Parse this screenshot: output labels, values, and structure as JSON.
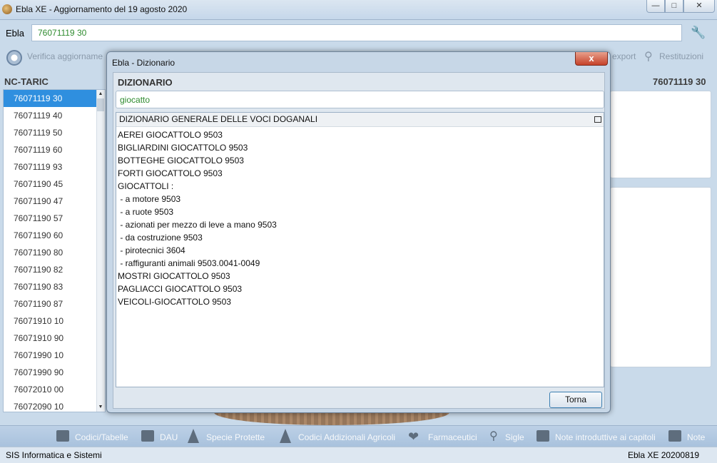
{
  "window": {
    "title": "Ebla XE - Aggiornamento del 19 agosto 2020"
  },
  "search_bar": {
    "label": "Ebla",
    "value": "76071119 30"
  },
  "toolbar": {
    "verify_label": "Verifica aggiorname",
    "export_label": "export",
    "restituzioni_label": "Restituzioni"
  },
  "left_panel": {
    "heading": "NC-TARIC",
    "items": [
      "76071119 30",
      "76071119 40",
      "76071119 50",
      "76071119 60",
      "76071119 93",
      "76071190 45",
      "76071190 47",
      "76071190 57",
      "76071190 60",
      "76071190 80",
      "76071190 82",
      "76071190 83",
      "76071190 87",
      "76071910 10",
      "76071910 90",
      "76071990 10",
      "76071990 90",
      "76072010 00",
      "76072090 10"
    ],
    "selected_index": 0
  },
  "right_panel": {
    "code": "76071119 30"
  },
  "dialog": {
    "title": "Ebla - Dizionario",
    "close_label": "x",
    "heading": "DIZIONARIO",
    "search_value": "giocatto",
    "list_header": "DIZIONARIO GENERALE DELLE VOCI DOGANALI",
    "entries": [
      "AEREI GIOCATTOLO 9503",
      "BIGLIARDINI GIOCATTOLO 9503",
      "BOTTEGHE GIOCATTOLO 9503",
      "FORTI GIOCATTOLO 9503",
      "GIOCATTOLI :",
      " - a motore 9503",
      " - a ruote 9503",
      " - azionati per mezzo di leve a mano 9503",
      " - da costruzione 9503",
      " - pirotecnici 3604",
      " - raffiguranti animali 9503.0041-0049",
      "MOSTRI GIOCATTOLO 9503",
      "PAGLIACCI GIOCATTOLO 9503",
      "VEICOLI-GIOCATTOLO 9503"
    ],
    "back_button": "Torna"
  },
  "bottom_toolbar": {
    "codici_tabelle": "Codici/Tabelle",
    "dau": "DAU",
    "specie_protette": "Specie Protette",
    "codici_agricoli": "Codici Addizionali Agricoli",
    "farmaceutici": "Farmaceutici",
    "sigle": "Sigle",
    "note_introduttive": "Note introduttive ai capitoli",
    "note": "Note"
  },
  "status_bar": {
    "left": "SIS Informatica e Sistemi",
    "right": "Ebla XE 20200819"
  },
  "colors": {
    "selection": "#2f8fdf",
    "input_text": "#2e8b2e",
    "close_button": "#c6422a"
  }
}
